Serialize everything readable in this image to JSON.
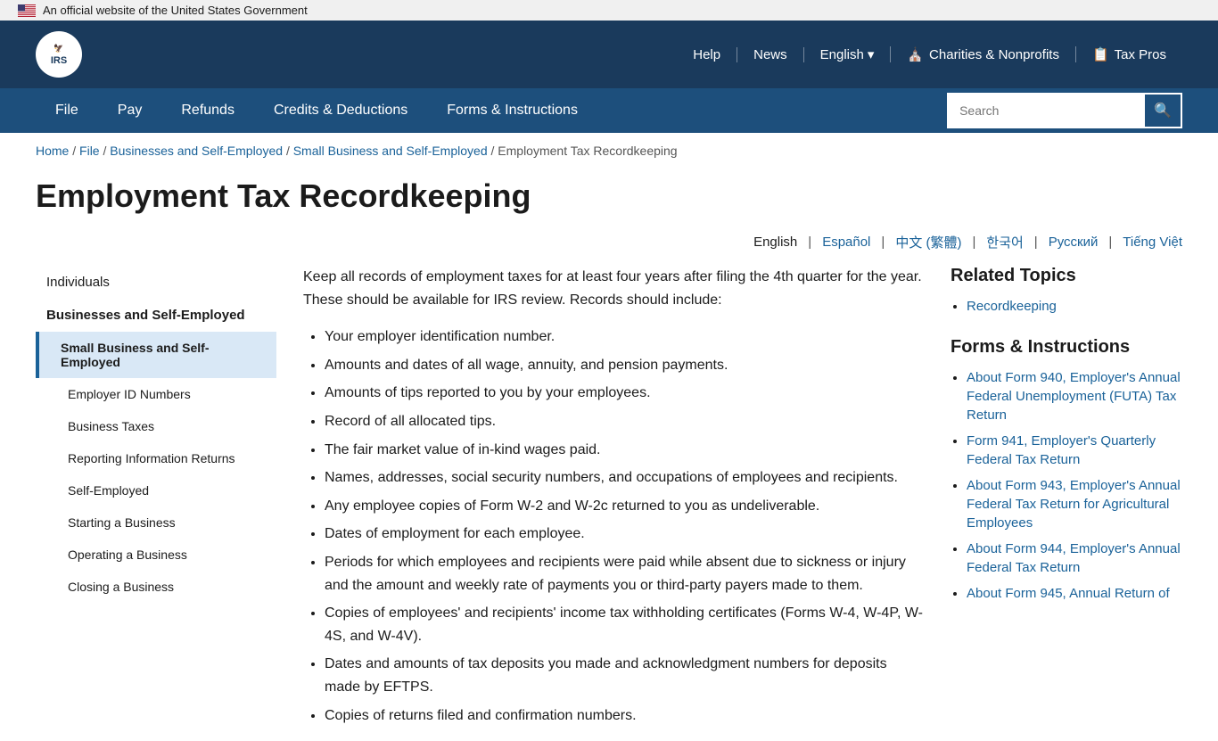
{
  "govBanner": {
    "text": "An official website of the United States Government"
  },
  "header": {
    "logo": "IRS",
    "nav": [
      {
        "label": "Help",
        "id": "help"
      },
      {
        "label": "News",
        "id": "news"
      },
      {
        "label": "English",
        "id": "english",
        "hasDropdown": true
      },
      {
        "label": "Charities & Nonprofits",
        "id": "charities",
        "hasIcon": true
      },
      {
        "label": "Tax Pros",
        "id": "taxpros",
        "hasIcon": true
      }
    ]
  },
  "mainNav": {
    "items": [
      {
        "label": "File",
        "id": "file"
      },
      {
        "label": "Pay",
        "id": "pay"
      },
      {
        "label": "Refunds",
        "id": "refunds"
      },
      {
        "label": "Credits & Deductions",
        "id": "credits"
      },
      {
        "label": "Forms & Instructions",
        "id": "forms"
      }
    ],
    "search": {
      "placeholder": "Search",
      "label": "Search"
    }
  },
  "breadcrumb": {
    "items": [
      {
        "label": "Home",
        "href": "#"
      },
      {
        "label": "File",
        "href": "#"
      },
      {
        "label": "Businesses and Self-Employed",
        "href": "#"
      },
      {
        "label": "Small Business and Self-Employed",
        "href": "#"
      },
      {
        "label": "Employment Tax Recordkeeping",
        "href": null
      }
    ]
  },
  "pageTitle": "Employment Tax Recordkeeping",
  "languages": [
    {
      "label": "English",
      "active": true
    },
    {
      "label": "Español",
      "active": false
    },
    {
      "label": "中文 (繁體)",
      "active": false
    },
    {
      "label": "한국어",
      "active": false
    },
    {
      "label": "Русский",
      "active": false
    },
    {
      "label": "Tiếng Việt",
      "active": false
    }
  ],
  "sidebar": {
    "sections": [
      {
        "title": "Individuals",
        "items": []
      },
      {
        "title": "Businesses and Self-Employed",
        "active": true,
        "items": [
          {
            "label": "Small Business and Self-Employed",
            "active": true,
            "level": 1
          },
          {
            "label": "Employer ID Numbers",
            "level": 2
          },
          {
            "label": "Business Taxes",
            "level": 2
          },
          {
            "label": "Reporting Information Returns",
            "level": 2
          },
          {
            "label": "Self-Employed",
            "level": 2
          },
          {
            "label": "Starting a Business",
            "level": 2
          },
          {
            "label": "Operating a Business",
            "level": 2
          },
          {
            "label": "Closing a Business",
            "level": 2
          }
        ]
      }
    ]
  },
  "mainContent": {
    "intro": "Keep all records of employment taxes for at least four years after filing the 4th quarter for the year. These should be available for IRS review. Records should include:",
    "bullets": [
      "Your employer identification number.",
      "Amounts and dates of all wage, annuity, and pension payments.",
      "Amounts of tips reported to you by your employees.",
      "Record of all allocated tips.",
      "The fair market value of in-kind wages paid.",
      "Names, addresses, social security numbers, and occupations of employees and recipients.",
      "Any employee copies of Form W-2 and W-2c returned to you as undeliverable.",
      "Dates of employment for each employee.",
      "Periods for which employees and recipients were paid while absent due to sickness or injury and the amount and weekly rate of payments you or third-party payers made to them.",
      "Copies of employees' and recipients' income tax withholding certificates (Forms W-4, W-4P, W-4S, and W-4V).",
      "Dates and amounts of tax deposits you made and acknowledgment numbers for deposits made by EFTPS.",
      "Copies of returns filed and confirmation numbers."
    ]
  },
  "relatedTopics": {
    "title": "Related Topics",
    "links": [
      {
        "label": "Recordkeeping"
      }
    ]
  },
  "formsInstructions": {
    "title": "Forms & Instructions",
    "links": [
      {
        "label": "About Form 940, Employer's Annual Federal Unemployment (FUTA) Tax Return"
      },
      {
        "label": "Form 941, Employer's Quarterly Federal Tax Return"
      },
      {
        "label": "About Form 943, Employer's Annual Federal Tax Return for Agricultural Employees"
      },
      {
        "label": "About Form 944, Employer's Annual Federal Tax Return"
      },
      {
        "label": "About Form 945, Annual Return of"
      }
    ]
  }
}
